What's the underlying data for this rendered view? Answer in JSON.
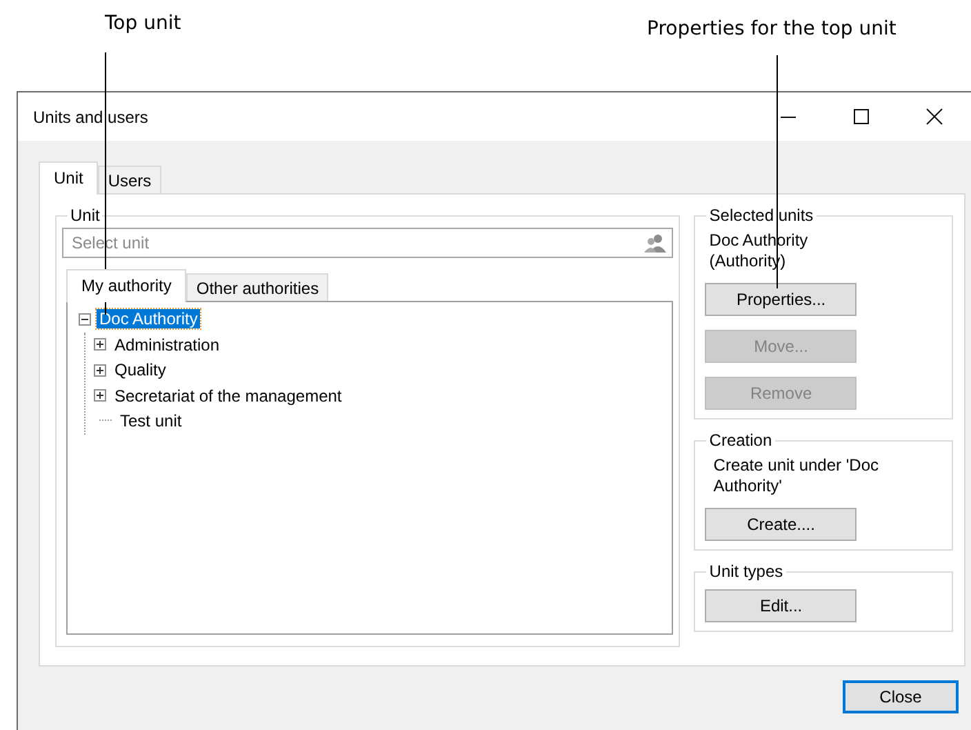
{
  "annotations": [
    {
      "text": "Top unit"
    },
    {
      "text": "Properties for the top unit"
    }
  ],
  "window": {
    "title": "Units and users"
  },
  "tabs": [
    {
      "label": "Unit",
      "selected": true
    },
    {
      "label": "Users",
      "selected": false
    }
  ],
  "unit_group": {
    "title": "Unit",
    "search": {
      "placeholder": "Select unit"
    },
    "tabs": [
      {
        "label": "My authority",
        "selected": true
      },
      {
        "label": "Other authorities",
        "selected": false
      }
    ],
    "tree": [
      {
        "label": "Doc Authority",
        "expanded": true,
        "selected": true,
        "children": [
          {
            "label": "Administration",
            "expanded": false,
            "selected": false
          },
          {
            "label": "Quality",
            "expanded": false,
            "selected": false
          },
          {
            "label": "Secretariat of the management",
            "expanded": false,
            "selected": false
          },
          {
            "label": "Test unit",
            "selected": false
          }
        ]
      }
    ]
  },
  "selected_units": {
    "title": "Selected units",
    "text": "Doc Authority (Authority)",
    "buttons": [
      {
        "label": "Properties...",
        "disabled": false
      },
      {
        "label": "Move...",
        "disabled": true
      },
      {
        "label": "Remove",
        "disabled": true
      }
    ]
  },
  "creation": {
    "title": "Creation",
    "text": "Create unit under 'Doc Authority'",
    "buttons": [
      {
        "label": "Create....",
        "disabled": false
      }
    ]
  },
  "unit_types": {
    "title": "Unit types",
    "buttons": [
      {
        "label": "Edit...",
        "disabled": false
      }
    ]
  },
  "footer_buttons": [
    {
      "label": "Close",
      "default": true
    }
  ]
}
